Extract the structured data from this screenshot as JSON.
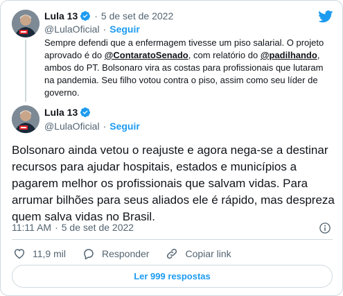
{
  "colors": {
    "accent": "#1d9bf0",
    "text_primary": "#0f1419",
    "text_secondary": "#536471",
    "border": "#cfd9de"
  },
  "icons": [
    "twitter-logo-icon",
    "verified-badge-icon",
    "info-icon",
    "heart-icon",
    "reply-icon",
    "link-icon"
  ],
  "quoted_tweet": {
    "author_name": "Lula 13",
    "separator": "·",
    "date": "5 de set de 2022",
    "handle": "@LulaOficial",
    "handle_sep": "·",
    "follow_label": "Seguir",
    "text_part1": "Sempre defendi que a enfermagem tivesse um piso salarial. O projeto aprovado é do ",
    "mention1": "@ContaratoSenado",
    "text_part2": ", com relatório do ",
    "mention2": "@padilhando",
    "text_part3": ", ambos do PT. Bolsonaro vira as costas para profissionais que lutaram na pandemia. Seu filho votou contra o piso, assim como seu líder de governo."
  },
  "main_tweet": {
    "author_name": "Lula 13",
    "handle": "@LulaOficial",
    "handle_sep": "·",
    "follow_label": "Seguir",
    "text": "Bolsonaro ainda vetou o reajuste e agora nega-se a destinar recursos para ajudar hospitais, estados e municípios a pagarem melhor os profissionais que salvam vidas. Para arrumar bilhões para seus aliados ele é rápido, mas despreza quem salva vidas no Brasil.",
    "time": "11:11 AM",
    "time_sep": "·",
    "date": "5 de set de 2022"
  },
  "actions": {
    "likes_count": "11,9 mil",
    "reply_label": "Responder",
    "copy_link_label": "Copiar link"
  },
  "replies_button_label": "Ler 999 respostas"
}
